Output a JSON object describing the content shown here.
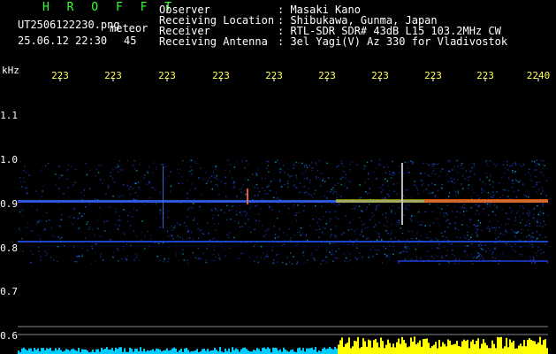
{
  "header": {
    "title": "H R O F F T",
    "file_name": "UT2506122230.png",
    "type_label": "meteor",
    "date_time": "25.06.12 22:30",
    "minute_value": "45",
    "observer_label": "Observer",
    "observer_value": ": Masaki Kano",
    "location_label": "Receiving Location",
    "location_value": ": Shibukawa, Gunma, Japan",
    "receiver_label": "Receiver",
    "receiver_value": ": RTL-SDR SDR# 43dB L15 103.2MHz CW",
    "antenna_label": "Receiving Antenna",
    "antenna_value": ": 3el Yagi(V) Az 330 for Vladivostok"
  },
  "axes": {
    "y_unit": "kHz",
    "time_ticks": [
      "223",
      "223",
      "223",
      "223",
      "223",
      "223",
      "223",
      "223",
      "223",
      "2240"
    ],
    "freq_ticks": [
      "1.1",
      "1.0",
      "0.9",
      "0.8",
      "0.7",
      "0.6"
    ]
  },
  "colors": {
    "background": "#000000",
    "label_text": "#ffffff",
    "tick_text": "#ffff55",
    "title_text": "#33ff33",
    "signal_high": "#ff2200",
    "signal_mid": "#ffff00",
    "signal_low": "#0033ff",
    "bottom_strip_left": "#00ccff",
    "bottom_strip_right": "#ffff00"
  }
}
